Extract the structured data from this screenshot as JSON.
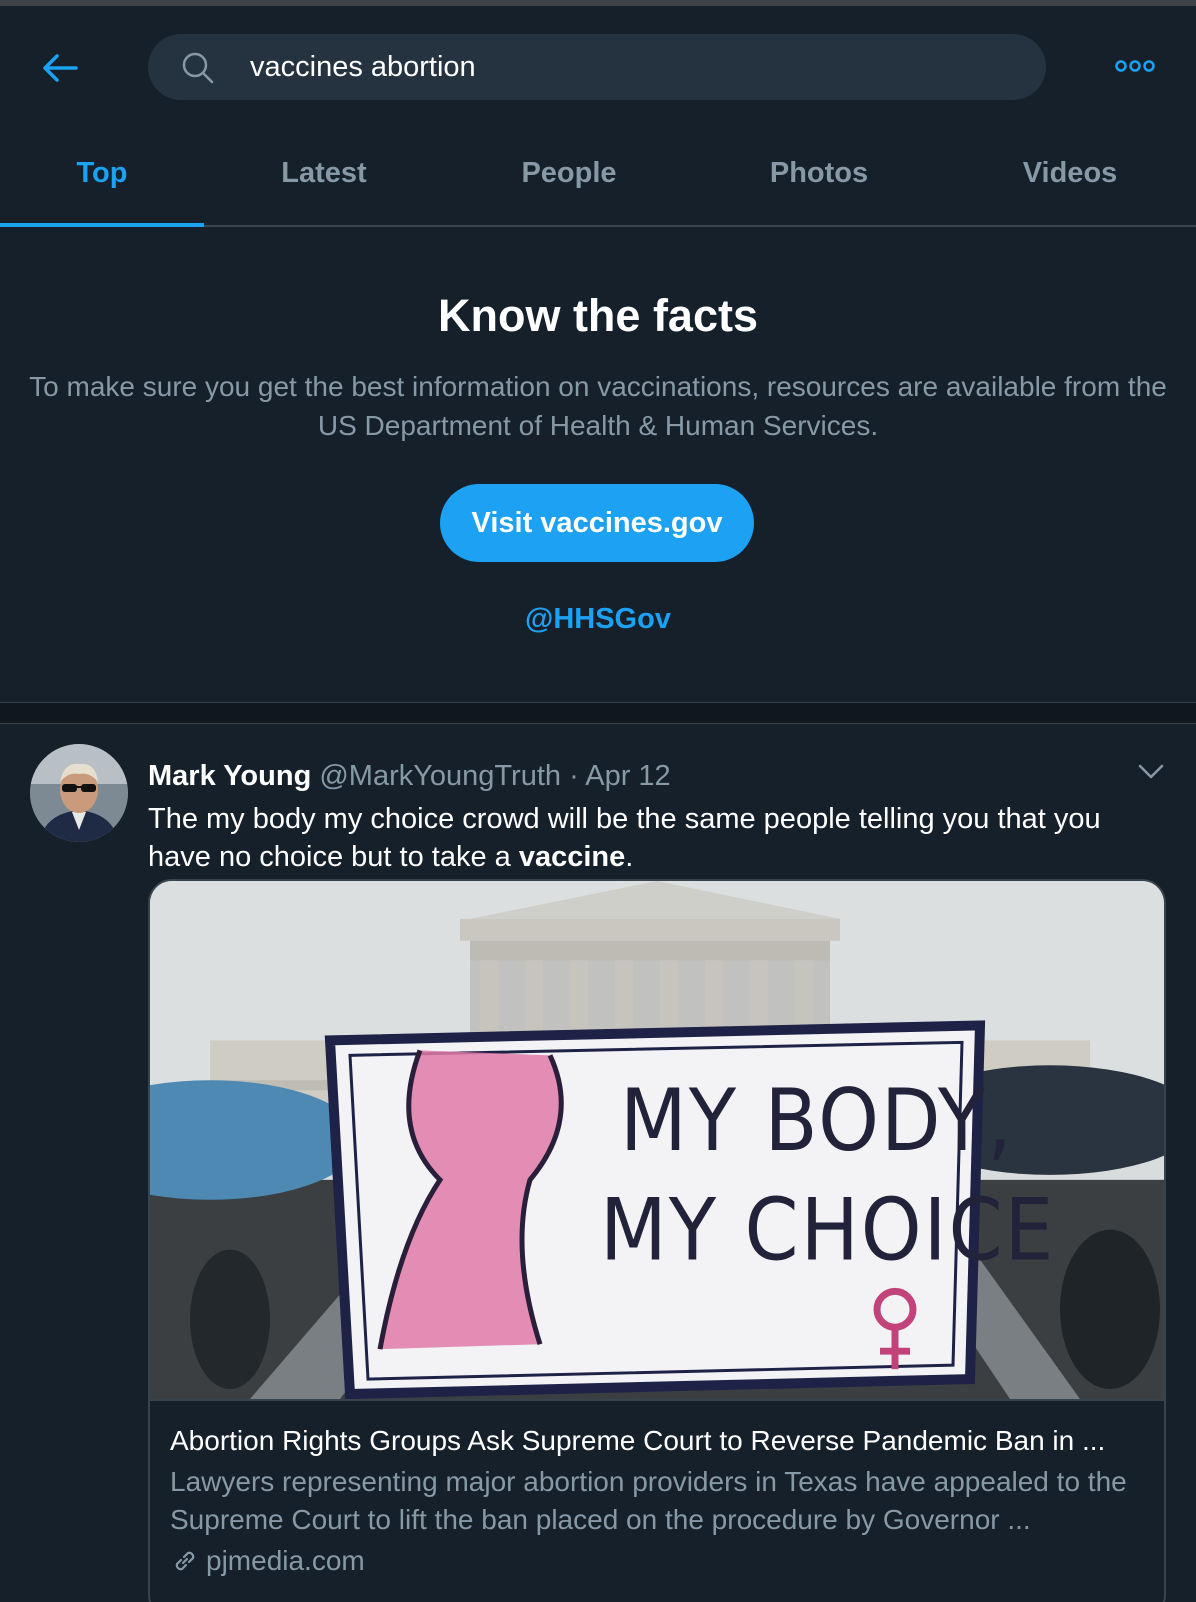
{
  "search": {
    "query": "vaccines abortion"
  },
  "tabs": [
    {
      "label": "Top",
      "active": true
    },
    {
      "label": "Latest",
      "active": false
    },
    {
      "label": "People",
      "active": false
    },
    {
      "label": "Photos",
      "active": false
    },
    {
      "label": "Videos",
      "active": false
    }
  ],
  "facts": {
    "title": "Know the facts",
    "body": "To make sure you get the best information on vaccinations, resources are available from the US Department of Health & Human Services.",
    "button": "Visit vaccines.gov",
    "handle": "@HHSGov"
  },
  "tweet": {
    "name": "Mark Young",
    "handle": "@MarkYoungTruth",
    "separator": "·",
    "date": "Apr 12",
    "text_before": "The my body my choice crowd will be the same people telling you that you have no choice but to take a ",
    "text_bold": "vaccine",
    "text_after": ".",
    "card": {
      "sign_line1": "MY BODY,",
      "sign_line2": "MY CHOICE",
      "title": "Abortion Rights Groups Ask Supreme Court to Reverse Pandemic Ban in ...",
      "description": "Lawyers representing major abortion providers in Texas have appealed to the Supreme Court to lift the ban placed on the procedure by Governor ...",
      "domain": "pjmedia.com"
    }
  },
  "icons": {
    "back": "arrow-left-icon",
    "search": "search-icon",
    "more": "more-dots-icon",
    "chevron": "chevron-down-icon",
    "link": "link-icon"
  },
  "colors": {
    "background": "#15202b",
    "accent": "#1da1f2",
    "muted_text": "#8899a6",
    "border": "#38444d"
  }
}
